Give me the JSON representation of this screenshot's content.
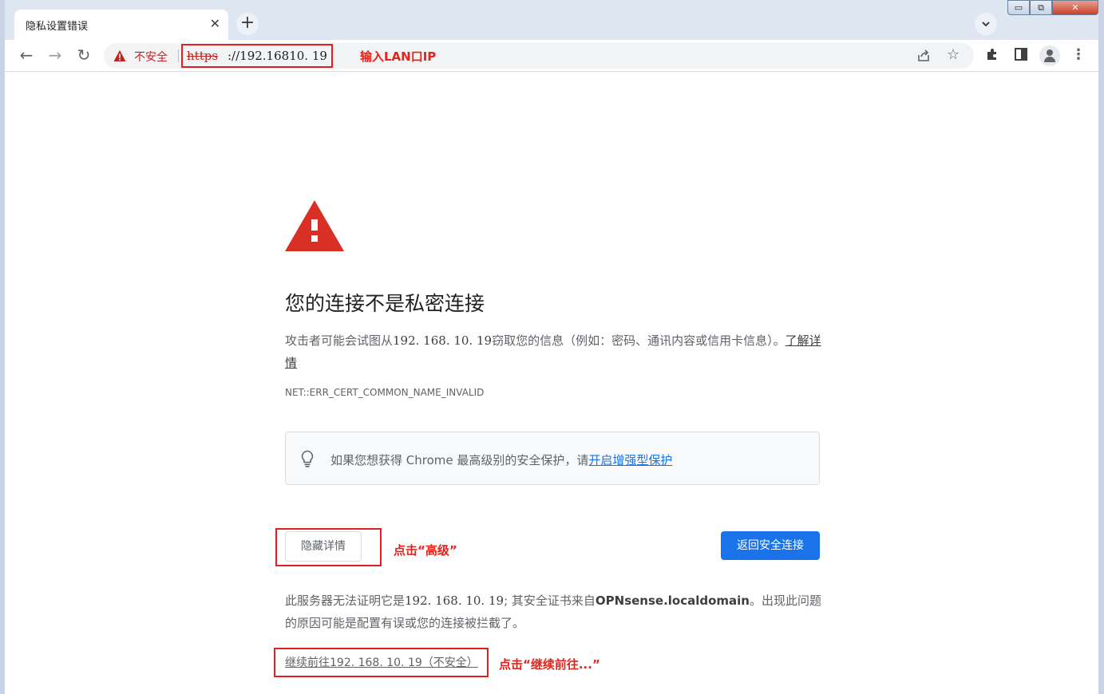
{
  "browser": {
    "tab_title": "隐私设置错误",
    "tab_close": "✕",
    "new_tab": "+",
    "tab_list": "⌄",
    "window_minimize": "▭",
    "window_maximize": "⧉",
    "window_close": "✕"
  },
  "toolbar": {
    "back": "←",
    "forward": "→",
    "reload": "↻",
    "security_label": "不安全",
    "url_scheme": "https",
    "url_rest": "://192.16810. 19",
    "icons": [
      "share-icon",
      "star-icon",
      "extensions-icon",
      "side-panel-icon",
      "profile-icon",
      "menu-icon"
    ]
  },
  "annotations": {
    "input_ip": "输入LAN口IP",
    "click_advanced": "点击“高级”",
    "click_proceed": "点击“继续前往...”",
    "color": "#e8211a"
  },
  "page": {
    "heading": "您的连接不是私密连接",
    "para_prefix": "攻击者可能会试图从",
    "para_ip": "192. 168. 10. 19",
    "para_suffix": "窃取您的信息（例如：密码、通讯内容或信用卡信息）。",
    "learn_more": "了解详情",
    "error_code": "NET::ERR_CERT_COMMON_NAME_INVALID",
    "enhanced_text": "如果您想获得 Chrome 最高级别的安全保护，请",
    "enhanced_link": "开启增强型保护",
    "hide_details_button": "隐藏详情",
    "back_to_safety_button": "返回安全连接",
    "details_prefix": "此服务器无法证明它是",
    "details_ip": "192. 168. 10. 19",
    "details_mid": "; 其安全证书来自",
    "details_issuer": "OPNsense.localdomain",
    "details_suffix": "。出现此问题的原因可能是配置有误或您的连接被拦截了。",
    "proceed_link": "继续前往192. 168. 10. 19（不安全）",
    "warning_color": "#d93025",
    "link_color": "#1a73e8"
  }
}
